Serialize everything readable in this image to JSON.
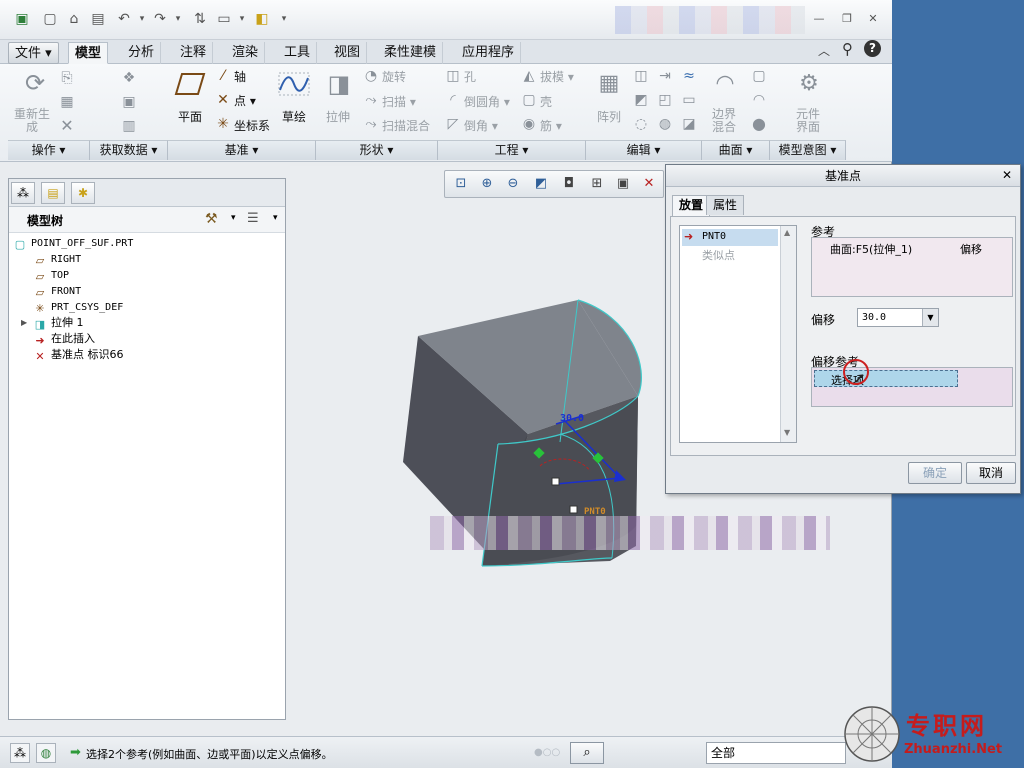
{
  "tabs": [
    "文件 ▾",
    "模型",
    "分析",
    "注释",
    "渲染",
    "工具",
    "视图",
    "柔性建模",
    "应用程序"
  ],
  "ribbon": {
    "operations": {
      "regenerate": "重新生\n成",
      "group": "操作 ▾"
    },
    "get_data": {
      "group": "获取数据 ▾"
    },
    "datum": {
      "plane": "平面",
      "axis": "轴",
      "point": "点 ▾",
      "csys": "坐标系",
      "sketch": "草绘",
      "group": "基准 ▾"
    },
    "shapes": {
      "extrude": "拉伸",
      "revolve": "旋转",
      "sweep": "扫描 ▾",
      "swept_blend": "扫描混合",
      "group": "形状 ▾"
    },
    "engineering": {
      "hole": "孔",
      "round": "倒圆角 ▾",
      "chamfer": "倒角 ▾",
      "draft": "拔模 ▾",
      "shell": "壳",
      "rib": "筋 ▾",
      "group": "工程 ▾"
    },
    "editing": {
      "pattern": "阵列",
      "group": "编辑 ▾"
    },
    "surfaces": {
      "boundary_blend": "边界\n混合",
      "group": "曲面 ▾"
    },
    "model_intent": {
      "component_interface": "元件\n界面",
      "group": "模型意图 ▾"
    }
  },
  "model_tree": {
    "title": "模型树",
    "items": [
      {
        "label": "POINT_OFF_SUF.PRT",
        "icon": "part-icon",
        "indent": 0
      },
      {
        "label": "RIGHT",
        "icon": "plane-icon",
        "indent": 1
      },
      {
        "label": "TOP",
        "icon": "plane-icon",
        "indent": 1
      },
      {
        "label": "FRONT",
        "icon": "plane-icon",
        "indent": 1
      },
      {
        "label": "PRT_CSYS_DEF",
        "icon": "csys-icon",
        "indent": 1
      },
      {
        "label": "拉伸 1",
        "icon": "extrude-icon",
        "indent": 1
      },
      {
        "label": "在此插入",
        "icon": "insert-arrow-icon",
        "indent": 1
      },
      {
        "label": "基准点 标识66",
        "icon": "datum-point-icon",
        "indent": 1
      }
    ]
  },
  "viewport": {
    "dim_value": "30.0",
    "point_label": "PNT0"
  },
  "dialog": {
    "title": "基准点",
    "tabs": [
      "放置",
      "属性"
    ],
    "points": [
      "PNT0",
      "类似点"
    ],
    "references_label": "参考",
    "reference_row": {
      "ref": "曲面:F5(拉伸_1)",
      "type": "偏移"
    },
    "offset_label": "偏移",
    "offset_value": "30.0",
    "offset_refs_label": "偏移参考",
    "offset_refs_placeholder": "选择项",
    "ok": "确定",
    "cancel": "取消"
  },
  "status": {
    "message": "选择2个参考(例如曲面、边或平面)以定义点偏移。",
    "filter": "全部"
  },
  "watermark": {
    "title": "专职网",
    "url": "Zhuanzhi.Net"
  },
  "colors": {
    "accent": "#3a6fb0",
    "edge": "#3fc9c9",
    "dim": "#1a2fd0",
    "point_label": "#d08b2a",
    "desktop": "#3e6fa6"
  }
}
